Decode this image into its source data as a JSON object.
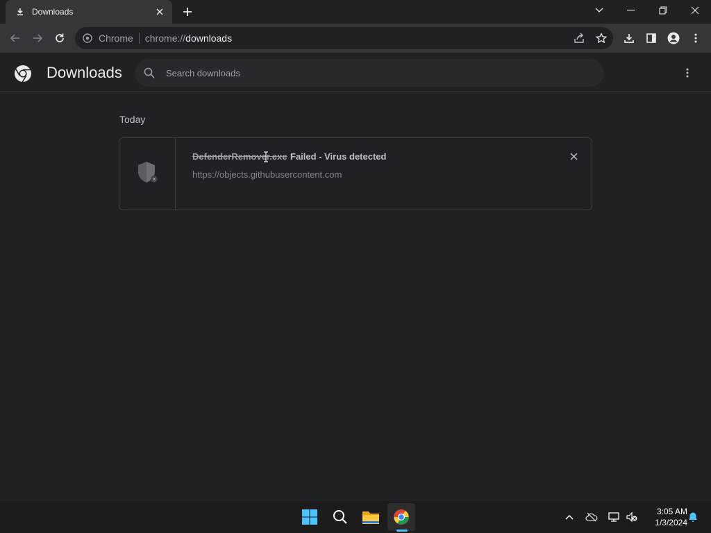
{
  "tab": {
    "title": "Downloads"
  },
  "omnibox": {
    "chip": "Chrome",
    "url_scheme": "chrome://",
    "url_host": "downloads"
  },
  "page": {
    "title": "Downloads",
    "search_placeholder": "Search downloads"
  },
  "section": {
    "label": "Today"
  },
  "download": {
    "filename": "DefenderRemover.exe",
    "status": "Failed - Virus detected",
    "source": "https://objects.githubusercontent.com",
    "icon": "shield-icon"
  },
  "taskbar": {
    "apps": [
      "windows-start-icon",
      "search-icon",
      "file-explorer-icon",
      "chrome-icon"
    ],
    "time": "3:05 AM",
    "date": "1/3/2024"
  },
  "colors": {
    "background": "#202124",
    "toolbar": "#35363a",
    "accent": "#4cc2ff"
  }
}
